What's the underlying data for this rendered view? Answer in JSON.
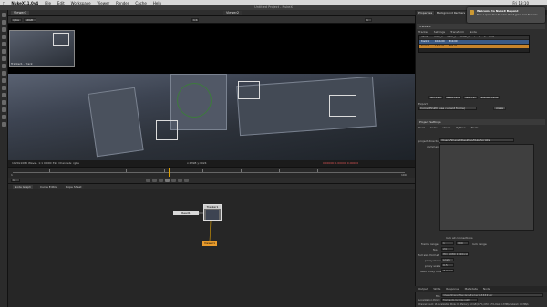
{
  "menubar": {
    "app": "NukeX11.0v4",
    "items": [
      "File",
      "Edit",
      "Workspace",
      "Viewer",
      "Render",
      "Cache",
      "Help"
    ],
    "time": "Fri 18:10"
  },
  "window": {
    "title": "Untitled Project - NukeX"
  },
  "viewer": {
    "tabs": [
      "Viewer1",
      "Viewer2"
    ],
    "channel": "rgba",
    "cs": "sRGB",
    "zoom": "1:1",
    "frame": "1",
    "thumb_label": "Tracker1 - Track",
    "status_left": "1920x1080  Wave - 1:1 0.000 392 Channels: rgba",
    "status_right": "x:1398 y:1024",
    "rgb": "0.00000 0.00000 0.00000"
  },
  "timeline": {
    "start": "1",
    "end": "100",
    "current": "1"
  },
  "nodegraph": {
    "tabs": [
      "Node Graph",
      "Curve Editor",
      "Dope Sheet"
    ],
    "nodes": [
      "Read1",
      "Tracker1",
      "Viewer1"
    ]
  },
  "right": {
    "tabs": [
      "Properties",
      "Background Renders"
    ],
    "notif_title": "Welcome to NukeX Beyond",
    "notif_text": "Take a quick tour to learn about great new features.",
    "node_title": "Tracker1",
    "subtabs": [
      "Tracker",
      "Settings",
      "Transform",
      "Node"
    ],
    "grid_headers": [
      "",
      "name",
      "track_x",
      "track_y",
      "offset_x",
      "T",
      "R",
      "S",
      "error"
    ],
    "grid_rows": [
      [
        "track 1",
        "1024.00",
        "810.00"
      ],
      [
        "track 2",
        "1324.01",
        "884.01"
      ]
    ],
    "buttons": [
      "add track",
      "delete tracks",
      "select all",
      "average tracks"
    ],
    "export_label": "Export",
    "export_value": "CornerPin2D (use current frame)",
    "create_label": "create",
    "second_title": "Project Settings",
    "second_tabs": [
      "Root",
      "Color",
      "Views",
      "Python",
      "Node"
    ],
    "project_dir_label": "project directory",
    "project_dir": "/Users/Shared/Desktop/NukeScripts",
    "comment_label": "comment",
    "fields": [
      {
        "label": "frame range",
        "v1": "1",
        "v2": "100"
      },
      {
        "label": "fps",
        "v1": "24"
      },
      {
        "label": "full size format",
        "v1": "HD_1080 1920x1080"
      },
      {
        "label": "proxy mode",
        "v1": "scale"
      },
      {
        "label": "proxy scale",
        "v1": "0.5"
      },
      {
        "label": "read proxy files",
        "v1": "if larger"
      }
    ],
    "lock_label": "lock all connections",
    "lock_range": "lock range",
    "bottom_tabs": [
      "Output",
      "Write",
      "Response",
      "Metadata",
      "Node"
    ],
    "file_label": "file",
    "file_value": "/Users/Shared/Renders/Tracker1_####.exr",
    "localization_label": "Localization Policy",
    "localization_value": "from auto-localize path",
    "status_line": "Channel Count: 16  Localization Mode: On  Memory: 3.0 GB (0.7%)  CPU: 0.5%  Disk: 0.3 MB/s  Network: 0.0 MB/s"
  }
}
